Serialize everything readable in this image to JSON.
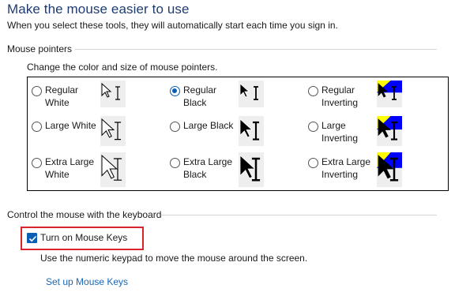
{
  "title": "Make the mouse easier to use",
  "subtitle": "When you select these tools, they will automatically start each time you sign in.",
  "pointers_section": {
    "heading": "Mouse pointers",
    "description": "Change the color and size of mouse pointers.",
    "options": [
      {
        "label": "Regular White",
        "selected": false,
        "scheme": "white",
        "size": "regular"
      },
      {
        "label": "Regular Black",
        "selected": true,
        "scheme": "black",
        "size": "regular"
      },
      {
        "label": "Regular Inverting",
        "selected": false,
        "scheme": "inverting",
        "size": "regular"
      },
      {
        "label": "Large White",
        "selected": false,
        "scheme": "white",
        "size": "large"
      },
      {
        "label": "Large Black",
        "selected": false,
        "scheme": "black",
        "size": "large"
      },
      {
        "label": "Large Inverting",
        "selected": false,
        "scheme": "inverting",
        "size": "large"
      },
      {
        "label": "Extra Large White",
        "selected": false,
        "scheme": "white",
        "size": "extra-large"
      },
      {
        "label": "Extra Large Black",
        "selected": false,
        "scheme": "black",
        "size": "extra-large"
      },
      {
        "label": "Extra Large Inverting",
        "selected": false,
        "scheme": "inverting",
        "size": "extra-large"
      }
    ]
  },
  "keyboard_section": {
    "heading": "Control the mouse with the keyboard",
    "checkbox_label": "Turn on Mouse Keys",
    "checkbox_checked": true,
    "hint": "Use the numeric keypad to move the mouse around the screen.",
    "link": "Set up Mouse Keys"
  },
  "colors": {
    "title": "#1e3b70",
    "accent": "#0a5fb4",
    "highlight_border": "#d9232d",
    "link": "#1a66b5",
    "inverting_blue": "#0000ff",
    "inverting_yellow": "#ffff00"
  }
}
